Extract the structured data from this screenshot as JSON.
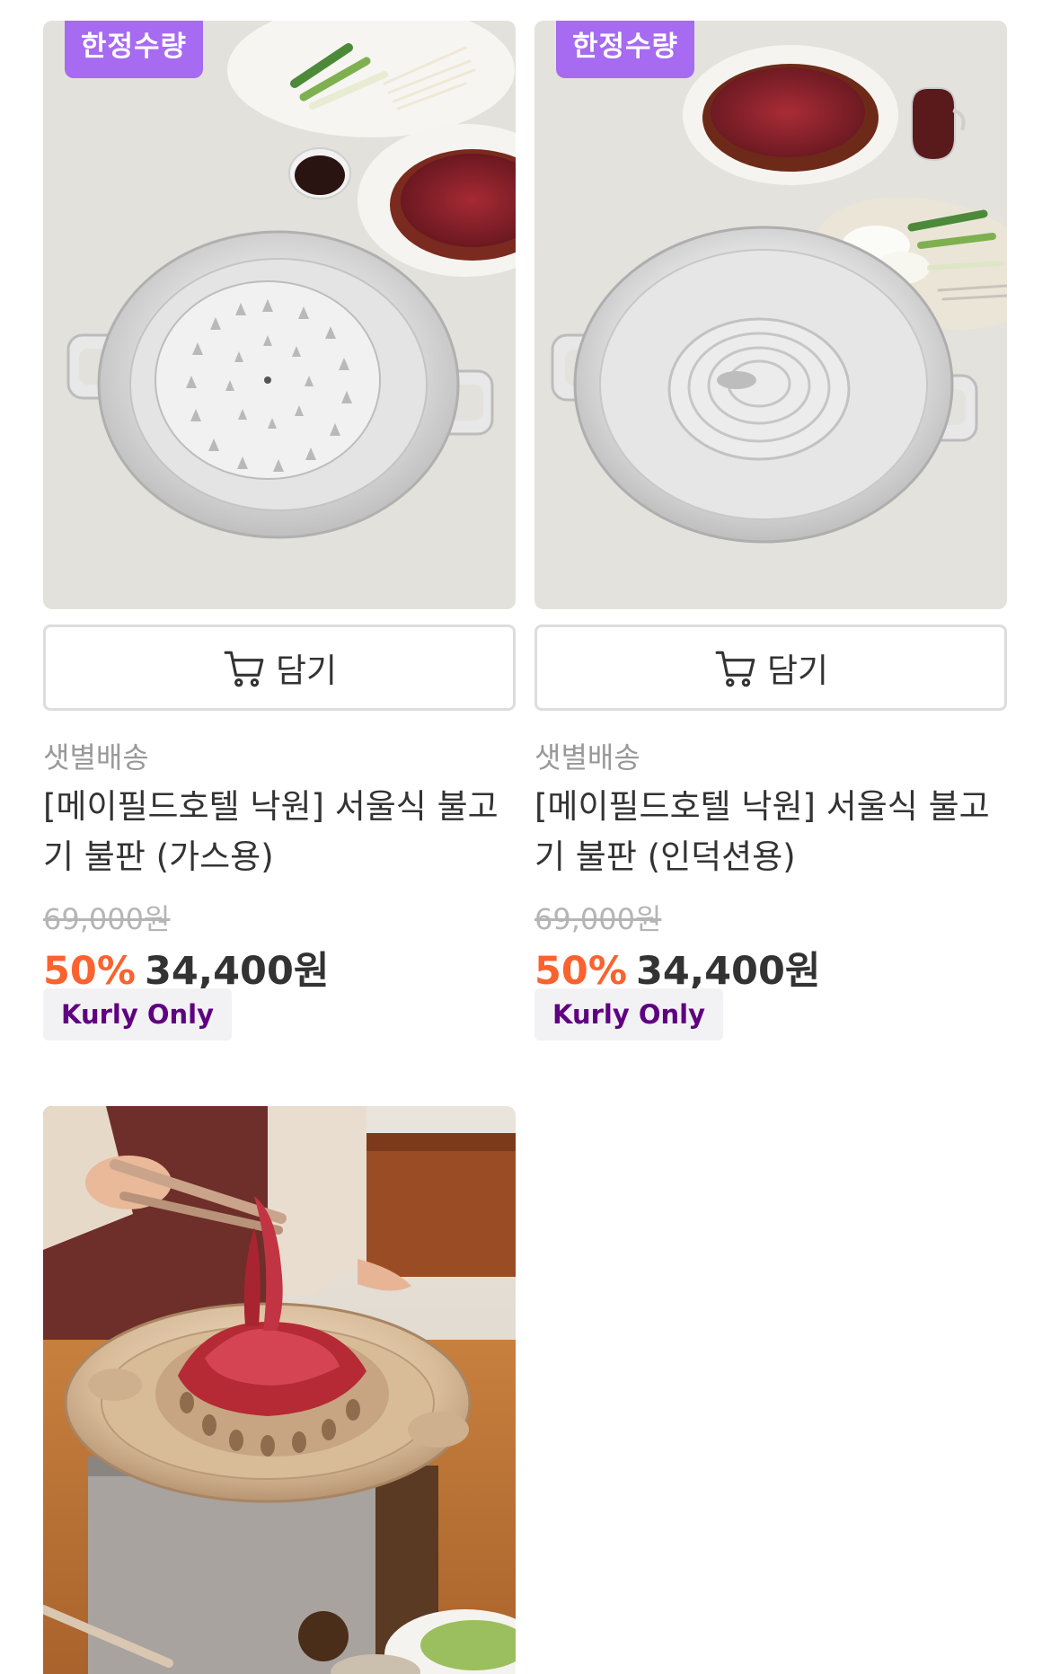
{
  "products": [
    {
      "badge": "한정수량",
      "cart_label": "담기",
      "delivery": "샛별배송",
      "title": "[메이필드호텔 낙원] 서울식 불고기 불판 (가스용)",
      "original_price": "69,000원",
      "discount": "50%",
      "sale_price": "34,400원",
      "tag": "Kurly Only"
    },
    {
      "badge": "한정수량",
      "cart_label": "담기",
      "delivery": "샛별배송",
      "title": "[메이필드호텔 낙원] 서울식 불고기 불판 (인덕션용)",
      "original_price": "69,000원",
      "discount": "50%",
      "sale_price": "34,400원",
      "tag": "Kurly Only"
    }
  ],
  "colors": {
    "badge": "#a66bf0",
    "discount": "#fa622f",
    "kurly_only_text": "#5f0080",
    "kurly_only_bg": "#f2f2f5"
  },
  "icons": [
    "cart-icon"
  ]
}
